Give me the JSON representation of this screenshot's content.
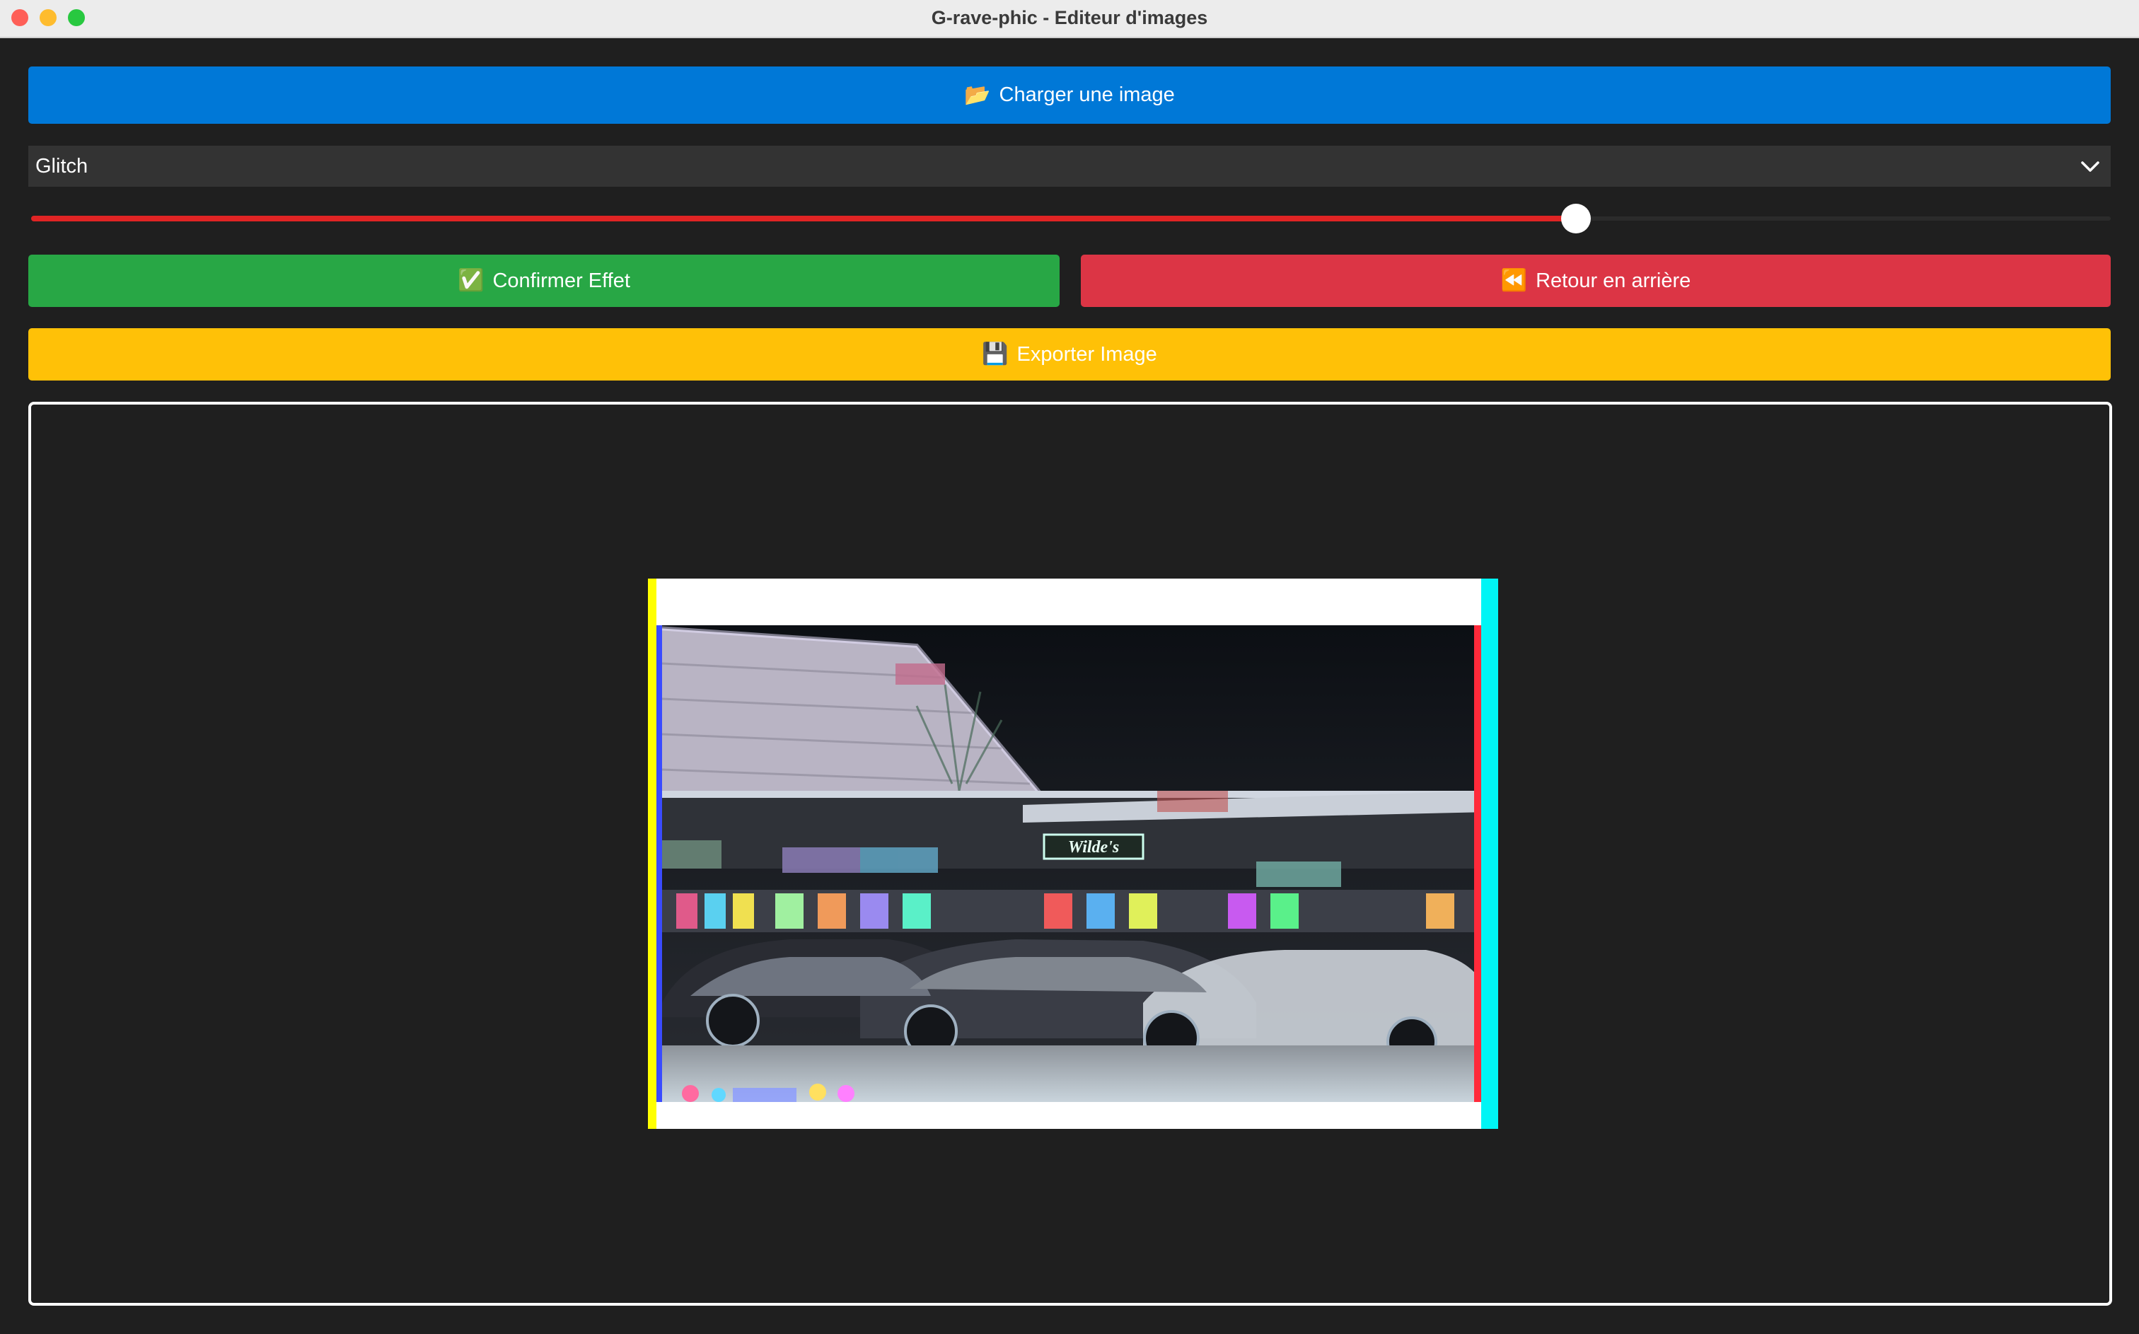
{
  "window": {
    "title": "G-rave-phic - Editeur d'images"
  },
  "toolbar": {
    "load_icon": "📂",
    "load_label": "Charger une image",
    "confirm_icon": "✅",
    "confirm_label": "Confirmer Effet",
    "back_icon": "⏪",
    "back_label": "Retour en arrière",
    "export_icon": "💾",
    "export_label": "Exporter Image"
  },
  "effect_select": {
    "selected": "Glitch"
  },
  "intensity_slider": {
    "value_fraction": 0.743
  },
  "colors": {
    "load": "#0078d7",
    "confirm": "#28a745",
    "back": "#dc3545",
    "export": "#ffc107",
    "slider_fill": "#e02424",
    "background": "#1f1f1f"
  },
  "preview": {
    "sign_text": "Wilde's"
  }
}
